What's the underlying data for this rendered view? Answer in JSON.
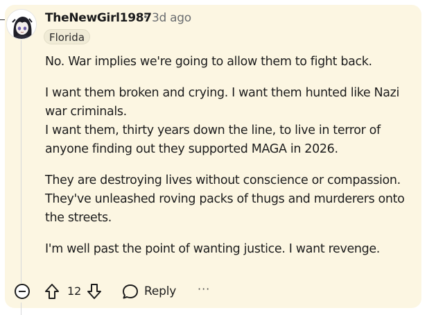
{
  "comment": {
    "username": "TheNewGirl1987",
    "separator": "•",
    "timestamp": "3d ago",
    "flair": "Florida",
    "paragraphs": [
      [
        "No. War implies we're going to allow them to fight back."
      ],
      [
        "I want them broken and crying. I want them hunted like Nazi",
        "war criminals.",
        "I want them, thirty years down the line, to live in terror of",
        "anyone finding out they supported MAGA in 2026."
      ],
      [
        "They are destroying lives without conscience or compassion.",
        "They've unleashed roving packs of thugs and murderers onto",
        "the streets."
      ],
      [
        "I'm well past the point of wanting justice. I want revenge."
      ]
    ]
  },
  "actions": {
    "collapse_icon": "minus-circle-icon",
    "upvote_icon": "arrow-up-icon",
    "vote_count": "12",
    "downvote_icon": "arrow-down-icon",
    "reply_icon": "speech-bubble-icon",
    "reply_label": "Reply",
    "more_label": "···"
  },
  "colors": {
    "highlight_background": "#fcf6e2",
    "meta_text": "#6a6d70",
    "body_text": "#1c1c1c"
  }
}
